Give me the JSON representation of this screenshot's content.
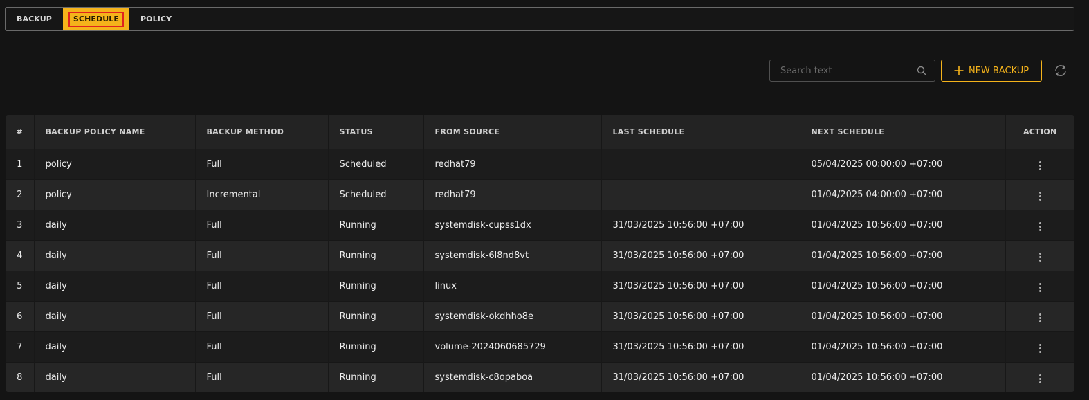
{
  "tabs": [
    {
      "label": "BACKUP"
    },
    {
      "label": "SCHEDULE"
    },
    {
      "label": "POLICY"
    }
  ],
  "active_tab": "SCHEDULE",
  "toolbar": {
    "search_placeholder": "Search text",
    "search_value": "",
    "new_backup_label": "NEW BACKUP",
    "accent_color": "#f5b31b"
  },
  "table": {
    "headers": {
      "num": "#",
      "policy": "BACKUP POLICY NAME",
      "method": "BACKUP METHOD",
      "status": "STATUS",
      "source": "FROM SOURCE",
      "last": "LAST SCHEDULE",
      "next": "NEXT SCHEDULE",
      "action": "ACTION"
    },
    "rows": [
      {
        "num": "1",
        "policy": "policy",
        "method": "Full",
        "status": "Scheduled",
        "source": "redhat79",
        "last": "",
        "next": "05/04/2025 00:00:00 +07:00"
      },
      {
        "num": "2",
        "policy": "policy",
        "method": "Incremental",
        "status": "Scheduled",
        "source": "redhat79",
        "last": "",
        "next": "01/04/2025 04:00:00 +07:00"
      },
      {
        "num": "3",
        "policy": "daily",
        "method": "Full",
        "status": "Running",
        "source": "systemdisk-cupss1dx",
        "last": "31/03/2025 10:56:00 +07:00",
        "next": "01/04/2025 10:56:00 +07:00"
      },
      {
        "num": "4",
        "policy": "daily",
        "method": "Full",
        "status": "Running",
        "source": "systemdisk-6l8nd8vt",
        "last": "31/03/2025 10:56:00 +07:00",
        "next": "01/04/2025 10:56:00 +07:00"
      },
      {
        "num": "5",
        "policy": "daily",
        "method": "Full",
        "status": "Running",
        "source": "linux",
        "last": "31/03/2025 10:56:00 +07:00",
        "next": "01/04/2025 10:56:00 +07:00"
      },
      {
        "num": "6",
        "policy": "daily",
        "method": "Full",
        "status": "Running",
        "source": "systemdisk-okdhho8e",
        "last": "31/03/2025 10:56:00 +07:00",
        "next": "01/04/2025 10:56:00 +07:00"
      },
      {
        "num": "7",
        "policy": "daily",
        "method": "Full",
        "status": "Running",
        "source": "volume-2024060685729",
        "last": "31/03/2025 10:56:00 +07:00",
        "next": "01/04/2025 10:56:00 +07:00"
      },
      {
        "num": "8",
        "policy": "daily",
        "method": "Full",
        "status": "Running",
        "source": "systemdisk-c8opaboa",
        "last": "31/03/2025 10:56:00 +07:00",
        "next": "01/04/2025 10:56:00 +07:00"
      }
    ]
  }
}
